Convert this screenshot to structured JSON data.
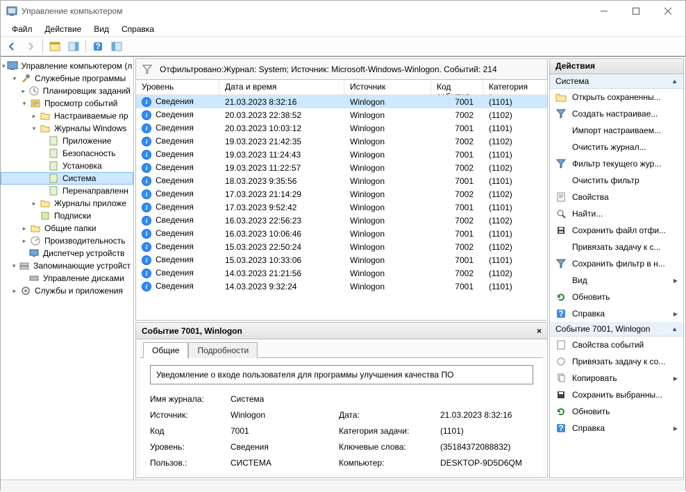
{
  "window": {
    "title": "Управление компьютером"
  },
  "menus": {
    "file": "Файл",
    "action": "Действие",
    "view": "Вид",
    "help": "Справка"
  },
  "tree": {
    "root": "Управление компьютером (л",
    "utilities": "Служебные программы",
    "scheduler": "Планировщик заданий",
    "eventviewer": "Просмотр событий",
    "customviews": "Настраиваемые пр",
    "winlogs": "Журналы Windows",
    "app": "Приложение",
    "security": "Безопасность",
    "setup": "Установка",
    "system": "Система",
    "forwarded": "Перенаправленн",
    "applogs": "Журналы приложе",
    "subs": "Подписки",
    "shared": "Общие папки",
    "perf": "Производительность",
    "devmgr": "Диспетчер устройств",
    "storage": "Запоминающие устройст",
    "diskmgmt": "Управление дисками",
    "services": "Службы и приложения"
  },
  "filter_text": "Отфильтровано:Журнал: System; Источник: Microsoft-Windows-Winlogon. Событий: 214",
  "columns": {
    "level": "Уровень",
    "datetime": "Дата и время",
    "source": "Источник",
    "eventid": "Код события",
    "category": "Категория з..."
  },
  "level_info": "Сведения",
  "events": [
    {
      "dt": "21.03.2023 8:32:16",
      "src": "Winlogon",
      "id": "7001",
      "cat": "(1101)",
      "sel": true
    },
    {
      "dt": "20.03.2023 22:38:52",
      "src": "Winlogon",
      "id": "7002",
      "cat": "(1102)"
    },
    {
      "dt": "20.03.2023 10:03:12",
      "src": "Winlogon",
      "id": "7001",
      "cat": "(1101)"
    },
    {
      "dt": "19.03.2023 21:42:35",
      "src": "Winlogon",
      "id": "7002",
      "cat": "(1102)"
    },
    {
      "dt": "19.03.2023 11:24:43",
      "src": "Winlogon",
      "id": "7001",
      "cat": "(1101)"
    },
    {
      "dt": "19.03.2023 11:22:57",
      "src": "Winlogon",
      "id": "7002",
      "cat": "(1102)"
    },
    {
      "dt": "18.03.2023 9:35:56",
      "src": "Winlogon",
      "id": "7001",
      "cat": "(1101)"
    },
    {
      "dt": "17.03.2023 21:14:29",
      "src": "Winlogon",
      "id": "7002",
      "cat": "(1102)"
    },
    {
      "dt": "17.03.2023 9:52:42",
      "src": "Winlogon",
      "id": "7001",
      "cat": "(1101)"
    },
    {
      "dt": "16.03.2023 22:56:23",
      "src": "Winlogon",
      "id": "7002",
      "cat": "(1102)"
    },
    {
      "dt": "16.03.2023 10:06:46",
      "src": "Winlogon",
      "id": "7001",
      "cat": "(1101)"
    },
    {
      "dt": "15.03.2023 22:50:24",
      "src": "Winlogon",
      "id": "7002",
      "cat": "(1102)"
    },
    {
      "dt": "15.03.2023 10:33:06",
      "src": "Winlogon",
      "id": "7001",
      "cat": "(1101)"
    },
    {
      "dt": "14.03.2023 21:21:56",
      "src": "Winlogon",
      "id": "7002",
      "cat": "(1102)"
    },
    {
      "dt": "14.03.2023 9:32:24",
      "src": "Winlogon",
      "id": "7001",
      "cat": "(1101)"
    }
  ],
  "detail": {
    "title": "Событие 7001, Winlogon",
    "tab_general": "Общие",
    "tab_details": "Подробности",
    "message": "Уведомление о входе пользователя для программы улучшения качества ПО",
    "l_log": "Имя журнала:",
    "v_log": "Система",
    "l_src": "Источник:",
    "v_src": "Winlogon",
    "l_date": "Дата:",
    "v_date": "21.03.2023 8:32:16",
    "l_code": "Код",
    "v_code": "7001",
    "l_cat": "Категория задачи:",
    "v_cat": "(1101)",
    "l_level": "Уровень:",
    "v_level": "Сведения",
    "l_kw": "Ключевые слова:",
    "v_kw": "(35184372088832)",
    "l_user": "Пользов.:",
    "v_user": "СИСТЕМА",
    "l_comp": "Компьютер:",
    "v_comp": "DESKTOP-9D5D6QM"
  },
  "actions": {
    "panel_title": "Действия",
    "group1": "Система",
    "open_saved": "Открыть сохраненны...",
    "create_custom": "Создать настраивае...",
    "import_custom": "Импорт настраиваем...",
    "clear_log": "Очистить журнал...",
    "filter_current": "Фильтр текущего жур...",
    "clear_filter": "Очистить фильтр",
    "properties": "Свойства",
    "find": "Найти...",
    "save_filtered": "Сохранить файл отфи...",
    "attach_task": "Привязать задачу к с...",
    "save_filter_as": "Сохранить фильтр в н...",
    "view": "Вид",
    "refresh": "Обновить",
    "help": "Справка",
    "group2": "Событие 7001, Winlogon",
    "event_props": "Свойства событий",
    "attach_task2": "Привязать задачу к со...",
    "copy": "Копировать",
    "save_selected": "Сохранить выбранны...",
    "refresh2": "Обновить",
    "help2": "Справка"
  }
}
